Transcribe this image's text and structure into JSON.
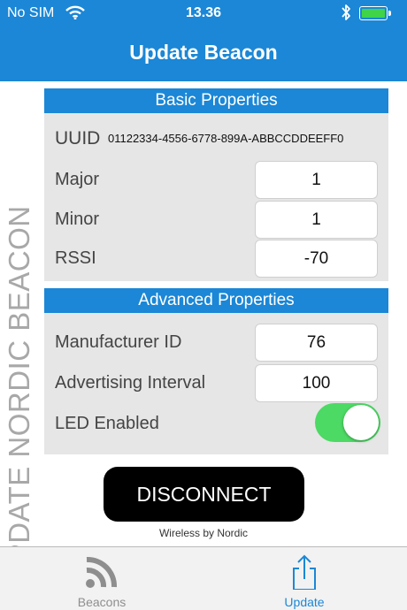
{
  "status_bar": {
    "carrier": "No SIM",
    "time": "13.36",
    "wifi_icon": "wifi-icon",
    "bluetooth_icon": "bluetooth-icon",
    "battery_icon": "battery-icon",
    "battery_color": "#3fd44a"
  },
  "nav": {
    "title": "Update Beacon"
  },
  "side_label": "UPDATE NORDIC BEACON",
  "basic": {
    "header": "Basic Properties",
    "uuid_label": "UUID",
    "uuid_value": "01122334-4556-6778-899A-ABBCCDDEEFF0",
    "major_label": "Major",
    "major_value": "1",
    "minor_label": "Minor",
    "minor_value": "1",
    "rssi_label": "RSSI",
    "rssi_value": "-70"
  },
  "advanced": {
    "header": "Advanced Properties",
    "manufacturer_label": "Manufacturer ID",
    "manufacturer_value": "76",
    "interval_label": "Advertising Interval",
    "interval_value": "100",
    "led_label": "LED Enabled",
    "led_enabled": true
  },
  "actions": {
    "disconnect_label": "DISCONNECT"
  },
  "footer": {
    "brand": "Wireless by Nordic"
  },
  "tabs": [
    {
      "label": "Beacons",
      "icon": "rss-icon",
      "active": false
    },
    {
      "label": "Update",
      "icon": "share-icon",
      "active": true
    }
  ],
  "colors": {
    "accent": "#1b87d6",
    "toggle_on": "#4cd964",
    "panel_bg": "#e6e6e6"
  }
}
